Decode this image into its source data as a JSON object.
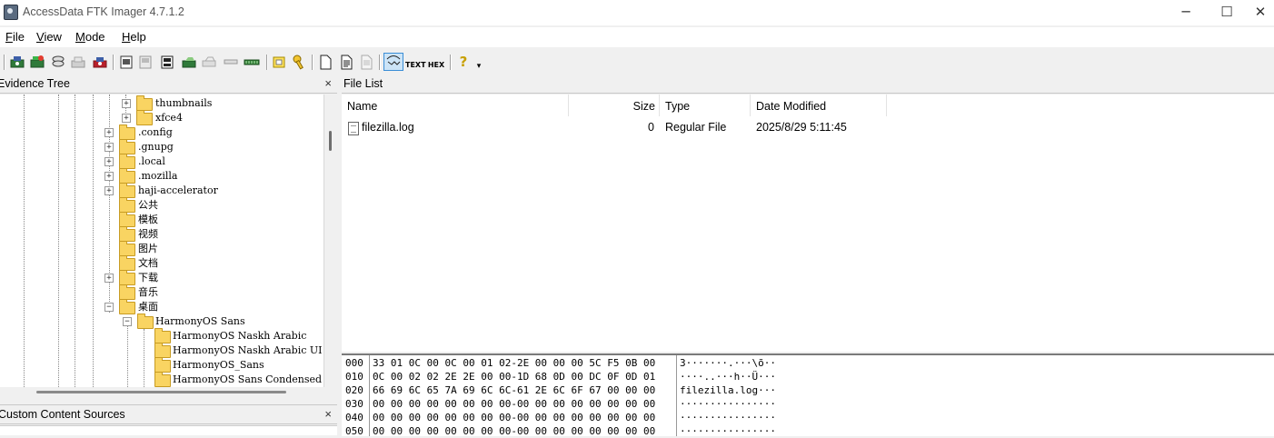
{
  "window": {
    "title": "AccessData FTK Imager 4.7.1.2",
    "minimize": "─",
    "maximize": "☐",
    "close": "✕"
  },
  "menu": {
    "file": {
      "first": "F",
      "rest": "ile"
    },
    "view": {
      "first": "V",
      "rest": "iew"
    },
    "mode": {
      "first": "M",
      "rest": "ode"
    },
    "help": {
      "first": "H",
      "rest": "elp"
    }
  },
  "toolbar": {
    "text_btn": "TEXT",
    "hex_btn": "HEX",
    "help_btn": "?",
    "dropdown": "▾"
  },
  "evidence_tree": {
    "title": "Evidence Tree",
    "close": "×",
    "rows": [
      {
        "label": "thumbnails",
        "pm": "+"
      },
      {
        "label": "xfce4",
        "pm": "+"
      },
      {
        "label": ".config",
        "pm": "+"
      },
      {
        "label": ".gnupg",
        "pm": "+"
      },
      {
        "label": ".local",
        "pm": "+"
      },
      {
        "label": ".mozilla",
        "pm": "+"
      },
      {
        "label": "haji-accelerator",
        "pm": "+"
      },
      {
        "label": "公共",
        "pm": ""
      },
      {
        "label": "模板",
        "pm": ""
      },
      {
        "label": "视频",
        "pm": ""
      },
      {
        "label": "图片",
        "pm": ""
      },
      {
        "label": "文档",
        "pm": ""
      },
      {
        "label": "下载",
        "pm": "+"
      },
      {
        "label": "音乐",
        "pm": ""
      },
      {
        "label": "桌面",
        "pm": "−"
      },
      {
        "label": "HarmonyOS Sans",
        "pm": "−"
      },
      {
        "label": "HarmonyOS Naskh Arabic",
        "pm": ""
      },
      {
        "label": "HarmonyOS Naskh Arabic UI",
        "pm": ""
      },
      {
        "label": "HarmonyOS_Sans",
        "pm": ""
      },
      {
        "label": "HarmonyOS Sans Condensed",
        "pm": ""
      }
    ]
  },
  "custom_content": {
    "title": "Custom Content Sources",
    "close": "×"
  },
  "file_list": {
    "title": "File List",
    "columns": {
      "name": "Name",
      "size": "Size",
      "type": "Type",
      "date": "Date Modified"
    },
    "rows": [
      {
        "name": "filezilla.log",
        "size": "0",
        "type": "Regular File",
        "date": "2025/8/29 5:11:45"
      }
    ]
  },
  "hex_view": {
    "rows": [
      {
        "off": "000",
        "bytes": "33 01 0C 00 0C 00 01 02-2E 00 00 00 5C F5 0B 00",
        "ascii": "3·······.···\\õ··"
      },
      {
        "off": "010",
        "bytes": "0C 00 02 02 2E 2E 00 00-1D 68 0D 00 DC 0F 0D 01",
        "ascii": "····..···h··Ü···"
      },
      {
        "off": "020",
        "bytes": "66 69 6C 65 7A 69 6C 6C-61 2E 6C 6F 67 00 00 00",
        "ascii": "filezilla.log···"
      },
      {
        "off": "030",
        "bytes": "00 00 00 00 00 00 00 00-00 00 00 00 00 00 00 00",
        "ascii": "················"
      },
      {
        "off": "040",
        "bytes": "00 00 00 00 00 00 00 00-00 00 00 00 00 00 00 00",
        "ascii": "················"
      },
      {
        "off": "050",
        "bytes": "00 00 00 00 00 00 00 00-00 00 00 00 00 00 00 00",
        "ascii": "················"
      }
    ]
  },
  "colors": {
    "accent": "#3b8ed6",
    "folder": "#f9d462"
  }
}
